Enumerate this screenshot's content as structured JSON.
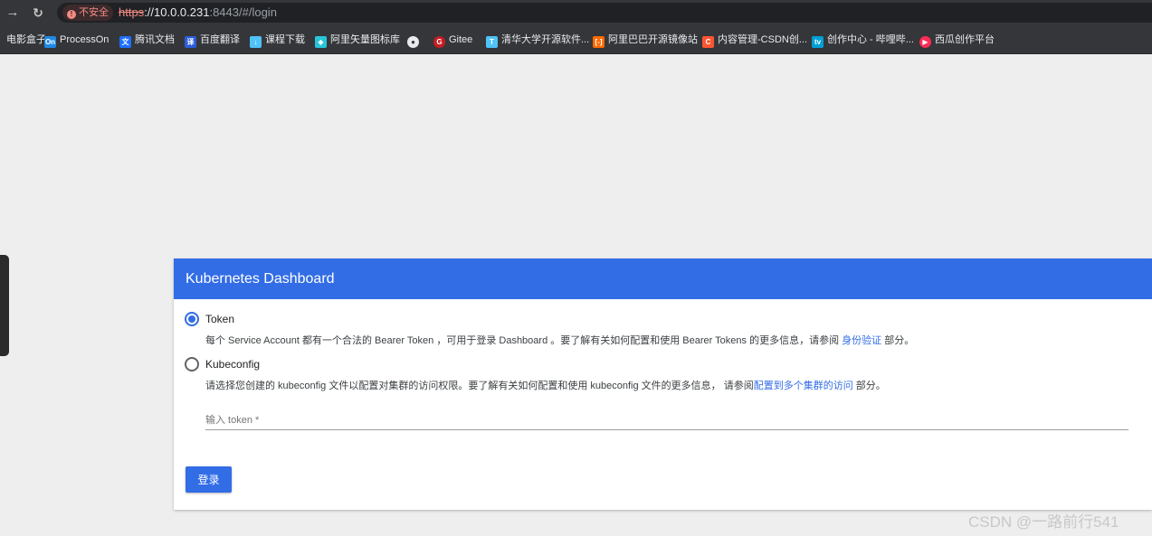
{
  "browser": {
    "insecure_label": "不安全",
    "url_scheme": "https",
    "url_host": "://10.0.0.231",
    "url_rest": ":8443/#/login"
  },
  "bookmarks": [
    {
      "label": "电影盒子",
      "icon": "folder-icon",
      "color": "#35363a"
    },
    {
      "label": "ProcessOn",
      "icon": "processon-icon",
      "color": "#1e88e5"
    },
    {
      "label": "腾讯文档",
      "icon": "tencent-docs-icon",
      "color": "#1e6fff"
    },
    {
      "label": "百度翻译",
      "icon": "baidu-translate-icon",
      "color": "#2a5cdb"
    },
    {
      "label": "课程下载",
      "icon": "download-icon",
      "color": "#4fc3f7"
    },
    {
      "label": "阿里矢量图标库",
      "icon": "iconfont-icon",
      "color": "#26c6da"
    },
    {
      "label": "",
      "icon": "globe-icon",
      "color": "#e8eaed"
    },
    {
      "label": "Gitee",
      "icon": "gitee-icon",
      "color": "#c71d23"
    },
    {
      "label": "清华大学开源软件...",
      "icon": "tuna-icon",
      "color": "#4fc3f7"
    },
    {
      "label": "阿里巴巴开源镜像站",
      "icon": "aliyun-icon",
      "color": "#ff6a00"
    },
    {
      "label": "内容管理-CSDN创...",
      "icon": "csdn-icon",
      "color": "#fc5531"
    },
    {
      "label": "创作中心 - 哔哩哔...",
      "icon": "bilibili-icon",
      "color": "#00a1d6"
    },
    {
      "label": "西瓜创作平台",
      "icon": "xigua-icon",
      "color": "#fe2c55"
    }
  ],
  "dashboard": {
    "title": "Kubernetes Dashboard",
    "token_option": {
      "label": "Token",
      "selected": true,
      "desc_prefix": "每个 Service Account 都有一个合法的 Bearer Token ，可用于登录 Dashboard 。要了解有关如何配置和使用 Bearer Tokens 的更多信息，请参阅 ",
      "desc_link": "身份验证",
      "desc_suffix": " 部分。"
    },
    "kubeconfig_option": {
      "label": "Kubeconfig",
      "selected": false,
      "desc_prefix": "请选择您创建的 kubeconfig 文件以配置对集群的访问权限。要了解有关如何配置和使用 kubeconfig 文件的更多信息， 请参阅",
      "desc_link": "配置到多个集群的访问",
      "desc_suffix": " 部分。"
    },
    "token_input": {
      "placeholder": "输入 token *",
      "value": ""
    },
    "login_button": "登录",
    "accent_color": "#326de6"
  },
  "watermark": "CSDN @一路前行541"
}
